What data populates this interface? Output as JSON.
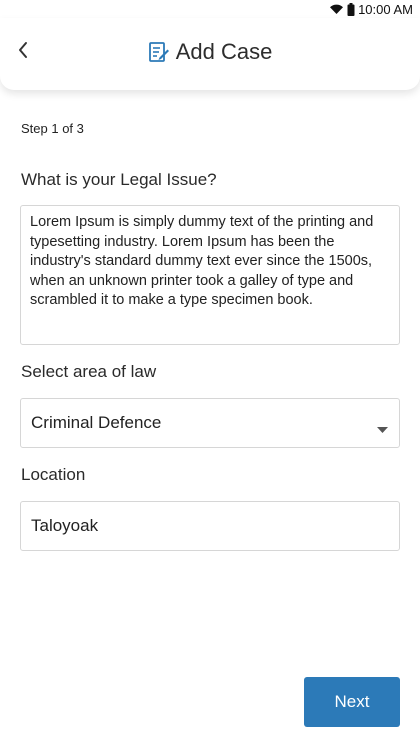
{
  "status_bar": {
    "time": "10:00 AM",
    "icons": [
      "wifi-icon",
      "battery-icon"
    ]
  },
  "header": {
    "title": "Add Case",
    "back_icon": "chevron-left-icon",
    "title_icon": "edit-document-icon",
    "accent_color": "#2c7ab8"
  },
  "form": {
    "step_label": "Step 1 of 3",
    "issue": {
      "label": "What is your Legal Issue?",
      "value": "Lorem Ipsum is simply dummy text of the printing and typesetting industry. Lorem Ipsum has been the industry's standard dummy text ever since the 1500s, when an unknown printer took a galley of type and scrambled it to make a type specimen book."
    },
    "area_of_law": {
      "label": "Select area of law",
      "selected": "Criminal Defence"
    },
    "location": {
      "label": "Location",
      "value": "Taloyoak"
    }
  },
  "actions": {
    "next_label": "Next",
    "next_color": "#2c7ab8"
  }
}
